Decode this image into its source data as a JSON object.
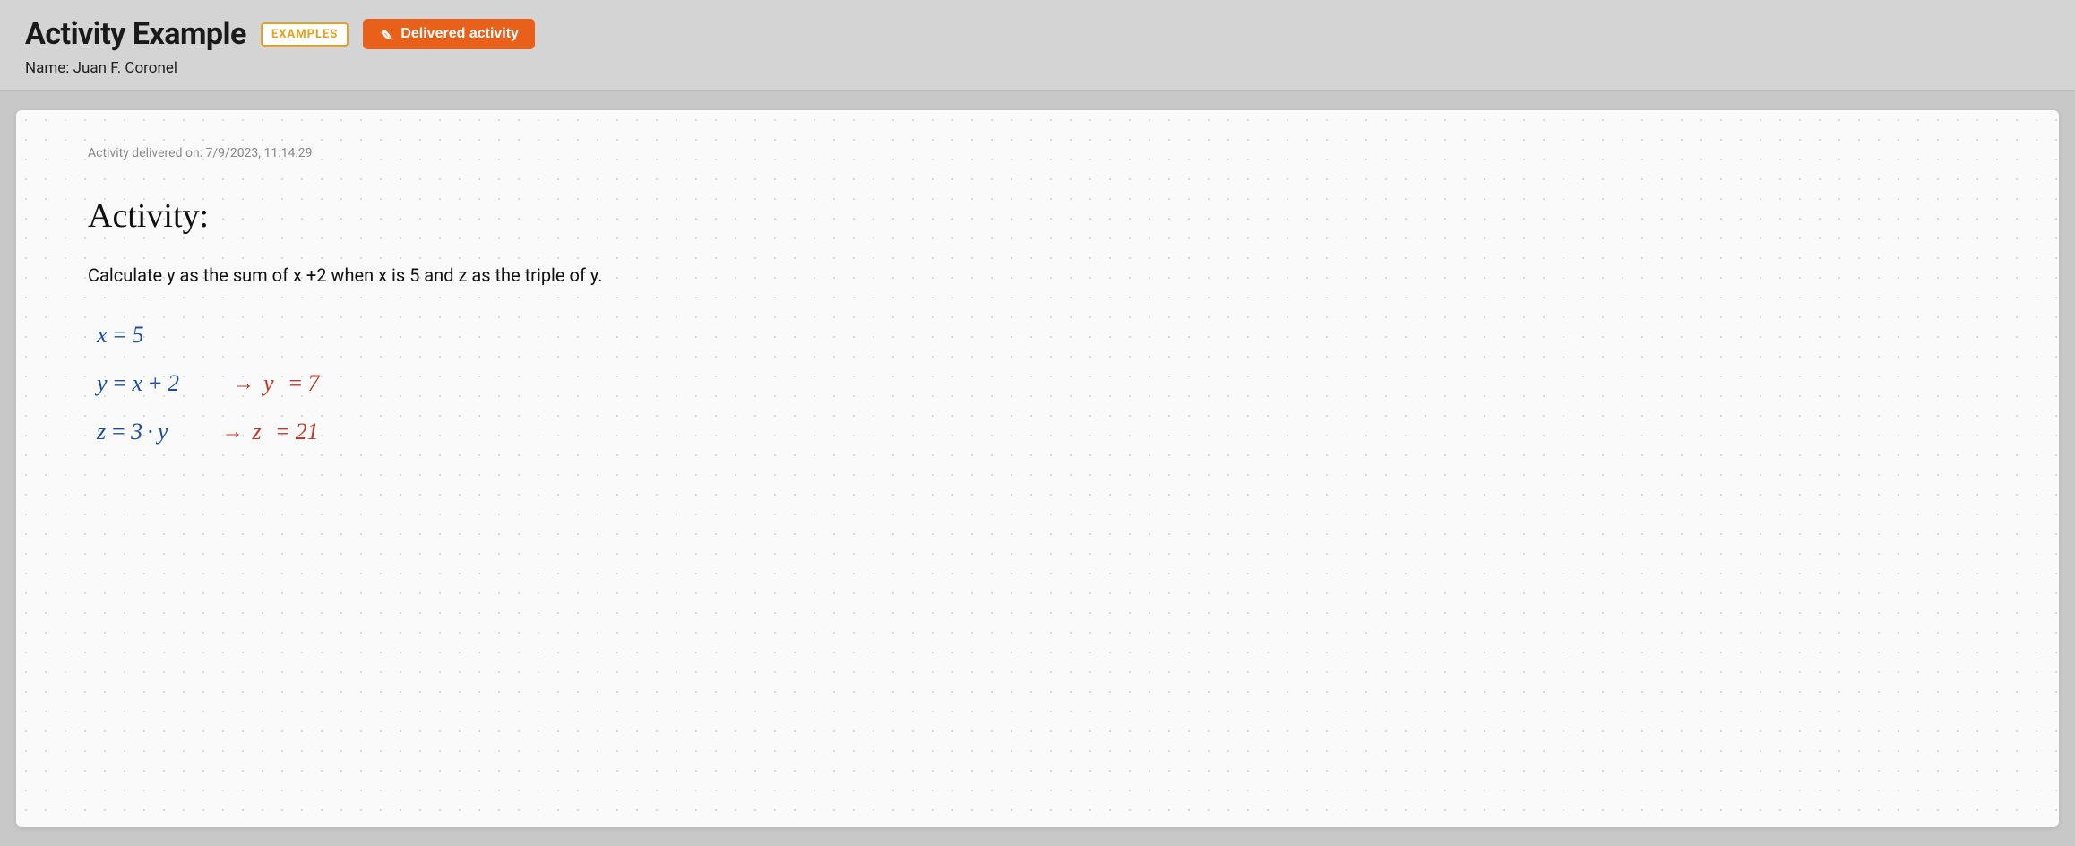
{
  "header": {
    "title": "Activity Example",
    "badge_label": "EXAMPLES",
    "delivered_btn_label": "Delivered activity",
    "subtitle": "Name: Juan F. Coronel"
  },
  "main": {
    "delivered_on": "Activity delivered on: 7/9/2023, 11:14:29",
    "activity_heading": "Activity:",
    "activity_description": "Calculate y as the sum of x +2 when x is 5 and z as the triple of y.",
    "math": [
      {
        "expr": "x = 5",
        "has_result": false
      },
      {
        "expr": "y = x + 2",
        "has_result": true,
        "result": "y = 7"
      },
      {
        "expr": "z = 3 · y",
        "has_result": true,
        "result": "z = 21"
      }
    ]
  },
  "icons": {
    "pencil": "✎"
  }
}
